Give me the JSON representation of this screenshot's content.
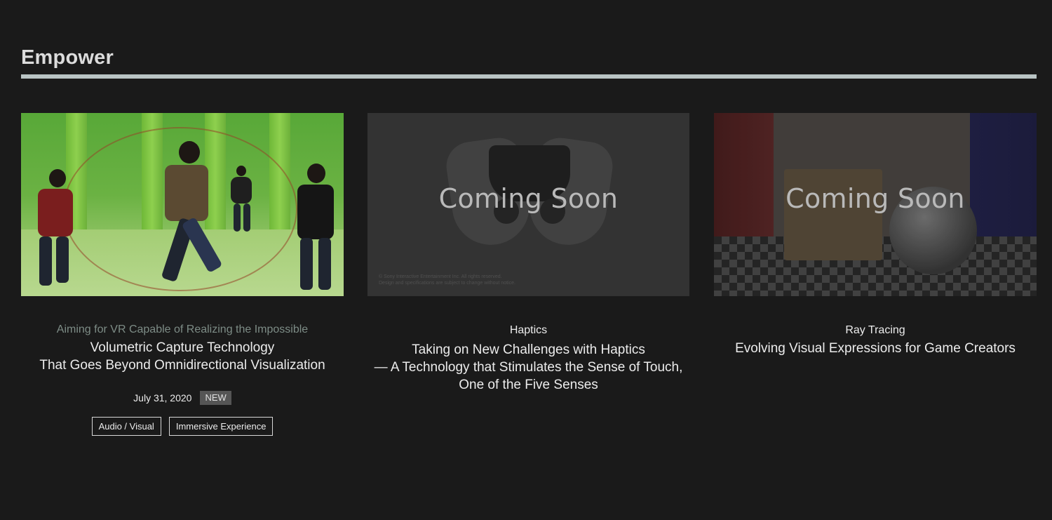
{
  "section": {
    "title": "Empower"
  },
  "cards": [
    {
      "kicker": "Aiming for VR Capable of Realizing the Impossible",
      "title": "Volumetric Capture Technology\nThat Goes Beyond Omnidirectional Visualization",
      "date": "July 31, 2020",
      "badge": "NEW",
      "tags": [
        "Audio / Visual",
        "Immersive Experience"
      ],
      "thumbnail": "green-screen-studio"
    },
    {
      "kicker": "Haptics",
      "title": "Taking on New Challenges with Haptics\n— A Technology that Stimulates the Sense of Touch,\nOne of the Five Senses",
      "overlay": "Coming Soon",
      "fine_print": "© Sony Interactive Entertainment Inc. All rights reserved.\nDesign and specifications are subject to change without notice.",
      "thumbnail": "controller"
    },
    {
      "kicker": "Ray Tracing",
      "title": "Evolving Visual Expressions for Game Creators",
      "overlay": "Coming Soon",
      "thumbnail": "ray-traced-room"
    }
  ],
  "colors": {
    "background": "#1a1a1a",
    "rule": "#b9c4c4",
    "kicker_muted": "#7d8c86",
    "badge_bg": "#555555"
  }
}
